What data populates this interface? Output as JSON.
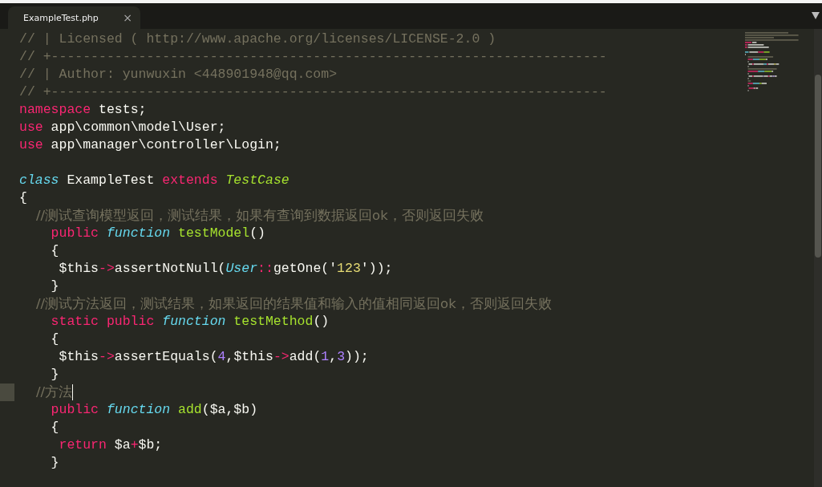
{
  "tabs": [
    {
      "label": "ExampleTest.php",
      "close": "×",
      "selected": true
    }
  ],
  "code_lines": [
    {
      "current": false,
      "tokens": [
        {
          "kind": "comment",
          "t": "// | Licensed ( http://www.apache.org/licenses/LICENSE-2.0 )"
        }
      ]
    },
    {
      "current": false,
      "tokens": [
        {
          "kind": "comment",
          "t": "// +----------------------------------------------------------------------"
        }
      ]
    },
    {
      "current": false,
      "tokens": [
        {
          "kind": "comment",
          "t": "// | Author: yunwuxin <448901948@qq.com>"
        }
      ]
    },
    {
      "current": false,
      "tokens": [
        {
          "kind": "comment",
          "t": "// +----------------------------------------------------------------------"
        }
      ]
    },
    {
      "current": false,
      "tokens": [
        {
          "kind": "keyword",
          "t": "namespace"
        },
        {
          "kind": "plain",
          "t": " tests;"
        }
      ]
    },
    {
      "current": false,
      "tokens": [
        {
          "kind": "keyword",
          "t": "use"
        },
        {
          "kind": "plain",
          "t": " app\\common\\model\\User;"
        }
      ]
    },
    {
      "current": false,
      "tokens": [
        {
          "kind": "keyword",
          "t": "use"
        },
        {
          "kind": "plain",
          "t": " app\\manager\\controller\\Login;"
        }
      ]
    },
    {
      "current": false
    },
    {
      "current": false,
      "tokens": [
        {
          "kind": "storage",
          "t": "class"
        },
        {
          "kind": "plain",
          "t": " ExampleTest "
        },
        {
          "kind": "keyword",
          "t": "extends "
        },
        {
          "kind": "inherited",
          "t": "TestCase"
        }
      ]
    },
    {
      "current": false,
      "tokens": [
        {
          "kind": "plain",
          "t": "{"
        }
      ]
    },
    {
      "current": false,
      "tokens": [
        {
          "kind": "comment",
          "t": "    //测试查询模型返回，测试结果，如果有查询到数据返回ok，否则返回失败"
        }
      ]
    },
    {
      "current": false,
      "tokens": [
        {
          "kind": "keyword",
          "t": "    public "
        },
        {
          "kind": "storage",
          "t": "function "
        },
        {
          "kind": "entity",
          "t": "testModel"
        },
        {
          "kind": "plain",
          "t": "()"
        }
      ]
    },
    {
      "current": false,
      "tokens": [
        {
          "kind": "plain",
          "t": "    {"
        }
      ]
    },
    {
      "current": false,
      "tokens": [
        {
          "kind": "plain",
          "t": "     $this"
        },
        {
          "kind": "keyword",
          "t": "->"
        },
        {
          "kind": "plain",
          "t": "assertNotNull("
        },
        {
          "kind": "support",
          "t": "User"
        },
        {
          "kind": "keyword",
          "t": "::"
        },
        {
          "kind": "plain",
          "t": "getOne('"
        },
        {
          "kind": "string",
          "t": "123"
        },
        {
          "kind": "plain",
          "t": "'));"
        }
      ]
    },
    {
      "current": false,
      "tokens": [
        {
          "kind": "plain",
          "t": "    }"
        }
      ]
    },
    {
      "current": false,
      "tokens": [
        {
          "kind": "comment",
          "t": "    //测试方法返回，测试结果，如果返回的结果值和输入的值相同返回ok，否则返回失败"
        }
      ]
    },
    {
      "current": false,
      "tokens": [
        {
          "kind": "keyword",
          "t": "    static public "
        },
        {
          "kind": "storage",
          "t": "function "
        },
        {
          "kind": "entity",
          "t": "testMethod"
        },
        {
          "kind": "plain",
          "t": "()"
        }
      ]
    },
    {
      "current": false,
      "tokens": [
        {
          "kind": "plain",
          "t": "    {"
        }
      ]
    },
    {
      "current": false,
      "tokens": [
        {
          "kind": "plain",
          "t": "     $this"
        },
        {
          "kind": "keyword",
          "t": "->"
        },
        {
          "kind": "plain",
          "t": "assertEquals("
        },
        {
          "kind": "number",
          "t": "4"
        },
        {
          "kind": "plain",
          "t": ",$this"
        },
        {
          "kind": "keyword",
          "t": "->"
        },
        {
          "kind": "plain",
          "t": "add("
        },
        {
          "kind": "number",
          "t": "1"
        },
        {
          "kind": "plain",
          "t": ","
        },
        {
          "kind": "number",
          "t": "3"
        },
        {
          "kind": "plain",
          "t": "));"
        }
      ]
    },
    {
      "current": false,
      "tokens": [
        {
          "kind": "plain",
          "t": "    }"
        }
      ]
    },
    {
      "current": true,
      "tokens": [
        {
          "kind": "comment",
          "t": "    //方法"
        }
      ]
    },
    {
      "current": false,
      "tokens": [
        {
          "kind": "keyword",
          "t": "    public "
        },
        {
          "kind": "storage",
          "t": "function "
        },
        {
          "kind": "entity",
          "t": "add"
        },
        {
          "kind": "plain",
          "t": "($a,$b)"
        }
      ]
    },
    {
      "current": false,
      "tokens": [
        {
          "kind": "plain",
          "t": "    {"
        }
      ]
    },
    {
      "current": false,
      "tokens": [
        {
          "kind": "keyword",
          "t": "     return "
        },
        {
          "kind": "plain",
          "t": "$a"
        },
        {
          "kind": "keyword",
          "t": "+"
        },
        {
          "kind": "plain",
          "t": "$b;"
        }
      ]
    },
    {
      "current": false,
      "tokens": [
        {
          "kind": "plain",
          "t": "    }"
        }
      ]
    }
  ]
}
